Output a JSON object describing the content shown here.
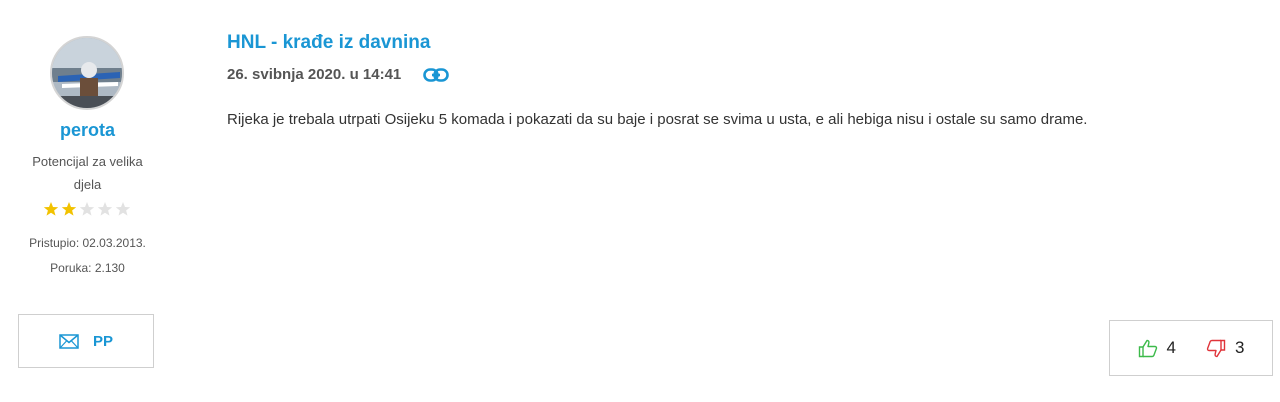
{
  "author": {
    "username": "perota",
    "rank": "Potencijal za velika djela",
    "rating": {
      "filled": 2,
      "total": 5
    },
    "joined": "Pristupio: 02.03.2013.",
    "posts": "Poruka: 2.130",
    "pm_label": "PP"
  },
  "post": {
    "title": "HNL - krađe iz davnina",
    "date": "26. svibnja 2020. u 14:41",
    "body": "Rijeka je trebala utrpati Osijeku 5 komada i pokazati da su baje i posrat se svima u usta, e ali hebiga nisu i ostale su samo drame."
  },
  "votes": {
    "up": "4",
    "down": "3"
  },
  "icons": {
    "avatar": "avatar-photo",
    "pm": "envelope-icon",
    "permalink": "link-icon",
    "upvote": "thumbs-up-icon",
    "downvote": "thumbs-down-icon",
    "star": "star-icon"
  },
  "colors": {
    "accent": "#1a96d4",
    "star_filled": "#f2c200",
    "star_empty": "#e2e2e2",
    "upvote": "#3cba4a",
    "downvote": "#e0343a"
  }
}
